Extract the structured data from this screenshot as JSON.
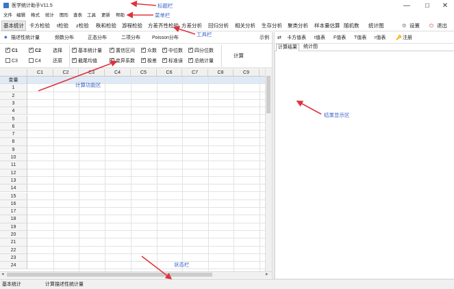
{
  "window": {
    "title": "医学统计助手V11.5",
    "minimize": "—",
    "maximize": "☐",
    "close": "✕"
  },
  "menubar": {
    "items": [
      "文件",
      "编辑",
      "格式",
      "统计",
      "图形",
      "查表",
      "工具",
      "更新",
      "帮助"
    ]
  },
  "toolbar": {
    "items": [
      "基本统计",
      "卡方检验",
      "t检验",
      "z检验",
      "秩和检验",
      "游程检验",
      "方差齐性检验",
      "方差分析",
      "回归分析",
      "相关分析",
      "生存分析",
      "聚类分析",
      "样本量估算",
      "随机数",
      "统计图"
    ],
    "active_index": 0,
    "settings_label": "设置",
    "exit_label": "退出"
  },
  "subtabs": {
    "items": [
      "描述性统计量",
      "频数分布",
      "正态分布",
      "二项分布",
      "Poisson分布"
    ],
    "active_index": 0,
    "example_label": "示例"
  },
  "options": {
    "columns": [
      {
        "label": "C1",
        "checked": true
      },
      {
        "label": "C2",
        "checked": true
      },
      {
        "label": "C3",
        "checked": false
      },
      {
        "label": "C4",
        "checked": false
      }
    ],
    "select_label": "选择",
    "restore_label": "还原",
    "stats": [
      {
        "label": "基本统计量",
        "checked": true
      },
      {
        "label": "置信区间",
        "checked": true
      },
      {
        "label": "众数",
        "checked": true
      },
      {
        "label": "中位数",
        "checked": true
      },
      {
        "label": "四分位数",
        "checked": true
      },
      {
        "label": "截尾均值",
        "checked": true
      },
      {
        "label": "变异系数",
        "checked": true
      },
      {
        "label": "极差",
        "checked": true
      },
      {
        "label": "标准误",
        "checked": true
      },
      {
        "label": "总统计量",
        "checked": true
      }
    ],
    "calc_label": "计算"
  },
  "grid": {
    "columns": [
      "C1",
      "C2",
      "C3",
      "C4",
      "C5",
      "C6",
      "C7",
      "C8",
      "C9"
    ],
    "header_row_label": "变量",
    "rows": [
      "1",
      "2",
      "3",
      "4",
      "5",
      "6",
      "7",
      "8",
      "9",
      "10",
      "11",
      "12",
      "13",
      "14",
      "15",
      "16",
      "17",
      "18",
      "19",
      "20",
      "21",
      "22",
      "23",
      "24"
    ]
  },
  "right_panel": {
    "toolbar": [
      "卡方值表",
      "t值表",
      "F值表",
      "T值表",
      "r值表"
    ],
    "register_label": "注册",
    "tabs": [
      "计算结果",
      "统计图"
    ],
    "active_tab": 0
  },
  "statusbar": {
    "left": "基本统计",
    "right": "计算描述性统计量"
  },
  "annotations": {
    "title_bar": "标题栏",
    "menu_bar": "菜单栏",
    "tool_bar": "工具栏",
    "calc_area": "计算功能区",
    "result_area": "结果显示区",
    "status_bar": "状态栏"
  },
  "colors": {
    "annotation_text": "#3c64c8",
    "arrow": "#e0323c",
    "selection": "#dfeaf7"
  }
}
